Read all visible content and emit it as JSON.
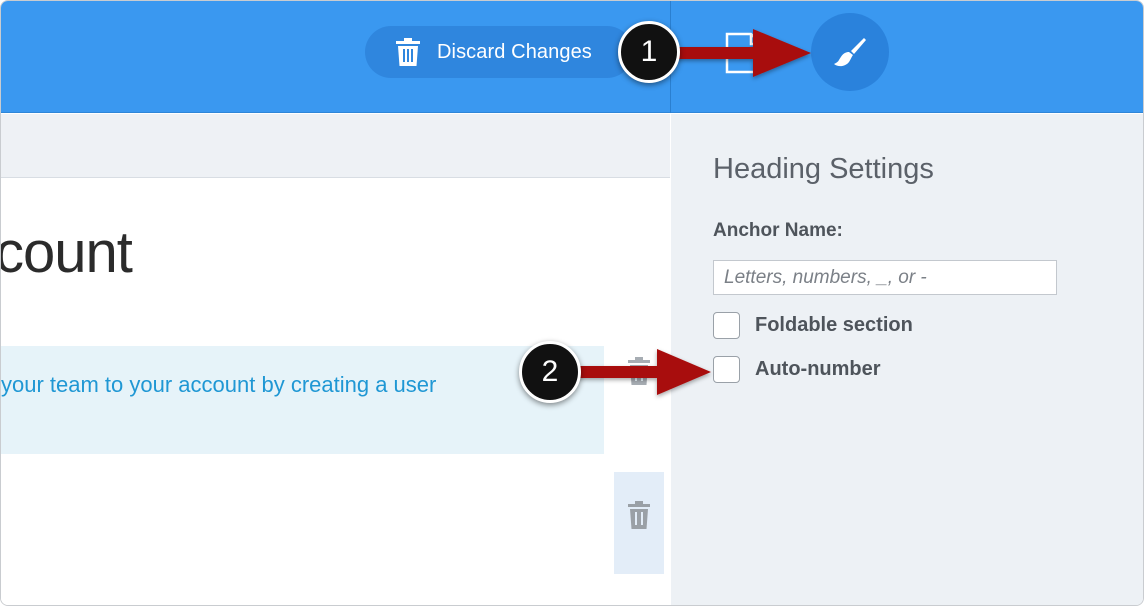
{
  "toolbar": {
    "discard_label": "Discard Changes",
    "discard_icon": "trash-icon",
    "document_icon": "document-icon",
    "brush_icon": "brush-icon",
    "bar_color": "#3a98f0"
  },
  "editor": {
    "heading_text": "count",
    "text_block_line": "your team to your account by creating a user",
    "text_color": "#1f97d4",
    "block_bg": "#e6f3f9"
  },
  "settings": {
    "title": "Heading Settings",
    "anchor_label": "Anchor Name:",
    "anchor_placeholder": "Letters, numbers, _, or -",
    "anchor_value": "",
    "options": [
      {
        "label": "Foldable section",
        "checked": false
      },
      {
        "label": "Auto-number",
        "checked": false
      }
    ]
  },
  "annotations": {
    "step1": "1",
    "step2": "2",
    "arrow_color": "#a80f0f"
  }
}
